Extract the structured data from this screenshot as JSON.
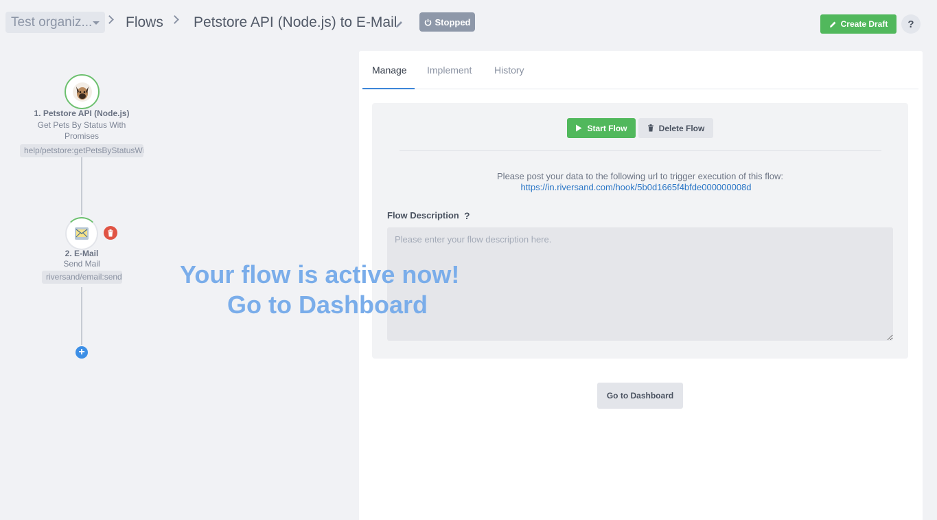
{
  "header": {
    "org_label": "Test organiz...",
    "breadcrumb_flows": "Flows",
    "flow_name": "Petstore API (Node.js) to E-Mail",
    "status": "Stopped",
    "create_draft": "Create Draft",
    "help": "?"
  },
  "flow": {
    "nodes": [
      {
        "title": "1. Petstore API (Node.js)",
        "subtitle_line1": "Get Pets By Status With",
        "subtitle_line2": "Promises",
        "tag": "help/petstore:getPetsByStatusWithPromises"
      },
      {
        "title": "2. E-Mail",
        "subtitle_line1": "Send Mail",
        "tag": "riversand/email:send"
      }
    ],
    "add_step": "+"
  },
  "overlay": {
    "line1": "Your flow is active now!",
    "line2": "Go to Dashboard"
  },
  "panel": {
    "tabs": [
      "Manage",
      "Implement",
      "History"
    ],
    "start_flow": "Start Flow",
    "delete_flow": "Delete Flow",
    "hook_text": "Please post your data to the following url to trigger execution of this flow:",
    "hook_url": "https://in.riversand.com/hook/5b0d1665f4bfde000000008d",
    "description_label": "Flow Description",
    "description_help": "?",
    "description_placeholder": "Please enter your flow description here.",
    "go_to_dashboard": "Go to Dashboard"
  },
  "colors": {
    "accent_green": "#51b85c",
    "status_gray": "#8e98a9",
    "link_blue": "#2a76c6",
    "overlay_blue": "#7aadea",
    "danger_red": "#e05444"
  }
}
